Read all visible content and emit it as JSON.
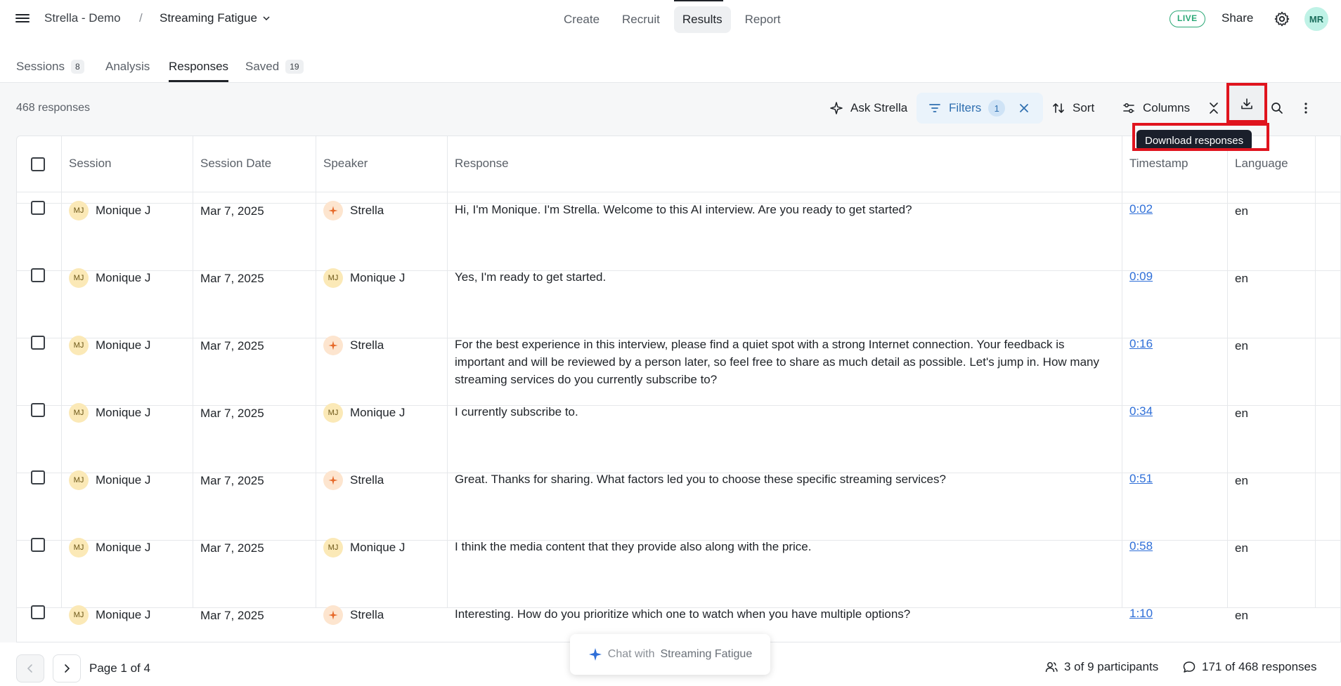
{
  "header": {
    "project": "Strella - Demo",
    "separator": "/",
    "study": "Streaming Fatigue",
    "nav": [
      "Create",
      "Recruit",
      "Results",
      "Report"
    ],
    "live_badge": "LIVE",
    "share": "Share",
    "avatar": "MR"
  },
  "subtabs": [
    {
      "label": "Sessions",
      "count": "8"
    },
    {
      "label": "Analysis",
      "count": ""
    },
    {
      "label": "Responses",
      "count": ""
    },
    {
      "label": "Saved",
      "count": "19"
    }
  ],
  "toolbar": {
    "response_count": "468 responses",
    "ask": "Ask Strella",
    "filters": "Filters",
    "filters_count": "1",
    "sort": "Sort",
    "columns": "Columns",
    "tooltip": "Download responses"
  },
  "table": {
    "columns": [
      "Session",
      "Session Date",
      "Speaker",
      "Response",
      "Timestamp",
      "Language"
    ],
    "rows": [
      {
        "session": "Monique J",
        "date": "Mar 7, 2025",
        "speaker": "Strella",
        "speaker_type": "ai",
        "response": "Hi, I'm Monique. I'm Strella. Welcome to this AI interview. Are you ready to get started?",
        "timestamp": "0:02",
        "language": "en"
      },
      {
        "session": "Monique J",
        "date": "Mar 7, 2025",
        "speaker": "Monique J",
        "speaker_type": "human",
        "response": "Yes, I'm ready to get started.",
        "timestamp": "0:09",
        "language": "en"
      },
      {
        "session": "Monique J",
        "date": "Mar 7, 2025",
        "speaker": "Strella",
        "speaker_type": "ai",
        "response": "For the best experience in this interview, please find a quiet spot with a strong Internet connection. Your feedback is important and will be reviewed by a person later, so feel free to share as much detail as possible. Let's jump in. How many streaming services do you currently subscribe to?",
        "timestamp": "0:16",
        "language": "en"
      },
      {
        "session": "Monique J",
        "date": "Mar 7, 2025",
        "speaker": "Monique J",
        "speaker_type": "human",
        "response": "I currently subscribe to.",
        "timestamp": "0:34",
        "language": "en"
      },
      {
        "session": "Monique J",
        "date": "Mar 7, 2025",
        "speaker": "Strella",
        "speaker_type": "ai",
        "response": "Great. Thanks for sharing. What factors led you to choose these specific streaming services?",
        "timestamp": "0:51",
        "language": "en"
      },
      {
        "session": "Monique J",
        "date": "Mar 7, 2025",
        "speaker": "Monique J",
        "speaker_type": "human",
        "response": "I think the media content that they provide also along with the price.",
        "timestamp": "0:58",
        "language": "en"
      },
      {
        "session": "Monique J",
        "date": "Mar 7, 2025",
        "speaker": "Strella",
        "speaker_type": "ai",
        "response": "Interesting. How do you prioritize which one to watch when you have multiple options?",
        "timestamp": "1:10",
        "language": "en"
      }
    ],
    "initials": "MJ"
  },
  "footer": {
    "page": "Page 1 of 4",
    "chat_prefix": "Chat with",
    "chat_study": "Streaming Fatigue",
    "participants": "3 of 9 participants",
    "responses": "171 of 468 responses"
  }
}
